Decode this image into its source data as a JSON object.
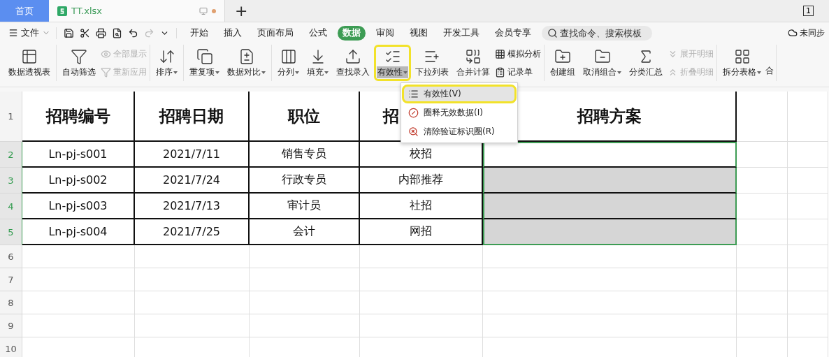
{
  "tab_bar": {
    "home": "首页",
    "file_tab": {
      "title": "TT.xlsx",
      "unsaved": true
    },
    "new_tab": "+",
    "window_count": "1"
  },
  "menu": {
    "file": "文件",
    "tabs": [
      {
        "label": "开始",
        "selected": false
      },
      {
        "label": "插入",
        "selected": false
      },
      {
        "label": "页面布局",
        "selected": false
      },
      {
        "label": "公式",
        "selected": false
      },
      {
        "label": "数据",
        "selected": true
      },
      {
        "label": "审阅",
        "selected": false
      },
      {
        "label": "视图",
        "selected": false
      },
      {
        "label": "开发工具",
        "selected": false
      },
      {
        "label": "会员专享",
        "selected": false
      }
    ],
    "search": {
      "placeholder": "查找命令、搜索模板"
    },
    "sync": "未同步"
  },
  "ribbon": {
    "groups": [
      {
        "items": [
          {
            "kind": "large",
            "label": "数据透视表",
            "dropdown": false,
            "highlighted": false
          }
        ]
      },
      {
        "items": [
          {
            "kind": "large",
            "label": "自动筛选",
            "dropdown": false,
            "highlighted": false
          },
          {
            "kind": "stack",
            "entries": [
              {
                "label": "全部显示",
                "disabled": true
              },
              {
                "label": "重新应用",
                "disabled": true
              }
            ]
          }
        ]
      },
      {
        "items": [
          {
            "kind": "large",
            "label": "排序",
            "dropdown": true,
            "highlighted": false
          }
        ]
      },
      {
        "items": [
          {
            "kind": "large",
            "label": "重复项",
            "dropdown": true,
            "highlighted": false
          },
          {
            "kind": "large",
            "label": "数据对比",
            "dropdown": true,
            "highlighted": false
          }
        ]
      },
      {
        "items": [
          {
            "kind": "large",
            "label": "分列",
            "dropdown": true,
            "highlighted": false
          },
          {
            "kind": "large",
            "label": "填充",
            "dropdown": true,
            "highlighted": false
          },
          {
            "kind": "large",
            "label": "查找录入",
            "dropdown": false,
            "highlighted": false
          },
          {
            "kind": "large",
            "label": "有效性",
            "dropdown": true,
            "highlighted": true
          },
          {
            "kind": "large",
            "label": "下拉列表",
            "dropdown": false,
            "highlighted": false
          },
          {
            "kind": "large",
            "label": "合并计算",
            "dropdown": false,
            "highlighted": false
          },
          {
            "kind": "stack",
            "entries": [
              {
                "label": "模拟分析",
                "disabled": false
              },
              {
                "label": "记录单",
                "disabled": false
              }
            ]
          }
        ]
      },
      {
        "items": [
          {
            "kind": "large",
            "label": "创建组",
            "dropdown": false,
            "highlighted": false
          },
          {
            "kind": "large",
            "label": "取消组合",
            "dropdown": true,
            "highlighted": false
          },
          {
            "kind": "large",
            "label": "分类汇总",
            "dropdown": false,
            "highlighted": false
          },
          {
            "kind": "stack",
            "entries": [
              {
                "label": "展开明细",
                "disabled": true
              },
              {
                "label": "折叠明细",
                "disabled": true
              }
            ]
          }
        ]
      },
      {
        "items": [
          {
            "kind": "large",
            "label": "拆分表格",
            "dropdown": true,
            "highlighted": false
          },
          {
            "kind": "cut",
            "label": "合"
          }
        ]
      }
    ]
  },
  "dropdown_menu": {
    "items": [
      {
        "label": "有效性(V)",
        "selected": true
      },
      {
        "label": "圈释无效数据(I)",
        "selected": false
      },
      {
        "label": "清除验证标识圈(R)",
        "selected": false
      }
    ]
  },
  "sheet": {
    "header": {
      "number": "1",
      "selected": false,
      "cells": [
        "招聘编号",
        "招聘日期",
        "职位",
        "招",
        "招聘方案"
      ]
    },
    "rows": [
      {
        "number": "2",
        "selected": true,
        "cells": [
          "Ln-pj-s001",
          "2021/7/11",
          "销售专员",
          "校招"
        ],
        "plan": {
          "selected": true,
          "active": true
        }
      },
      {
        "number": "3",
        "selected": true,
        "cells": [
          "Ln-pj-s002",
          "2021/7/24",
          "行政专员",
          "内部推荐"
        ],
        "plan": {
          "selected": true,
          "active": false
        }
      },
      {
        "number": "4",
        "selected": true,
        "cells": [
          "Ln-pj-s003",
          "2021/7/13",
          "审计员",
          "社招"
        ],
        "plan": {
          "selected": true,
          "active": false
        }
      },
      {
        "number": "5",
        "selected": true,
        "cells": [
          "Ln-pj-s004",
          "2021/7/25",
          "会计",
          "网招"
        ],
        "plan": {
          "selected": true,
          "active": false
        }
      }
    ],
    "empty_rows": [
      {
        "number": "6",
        "selected": false
      },
      {
        "number": "7",
        "selected": false
      },
      {
        "number": "8",
        "selected": false
      },
      {
        "number": "9",
        "selected": false
      },
      {
        "number": "10",
        "selected": false
      }
    ]
  }
}
